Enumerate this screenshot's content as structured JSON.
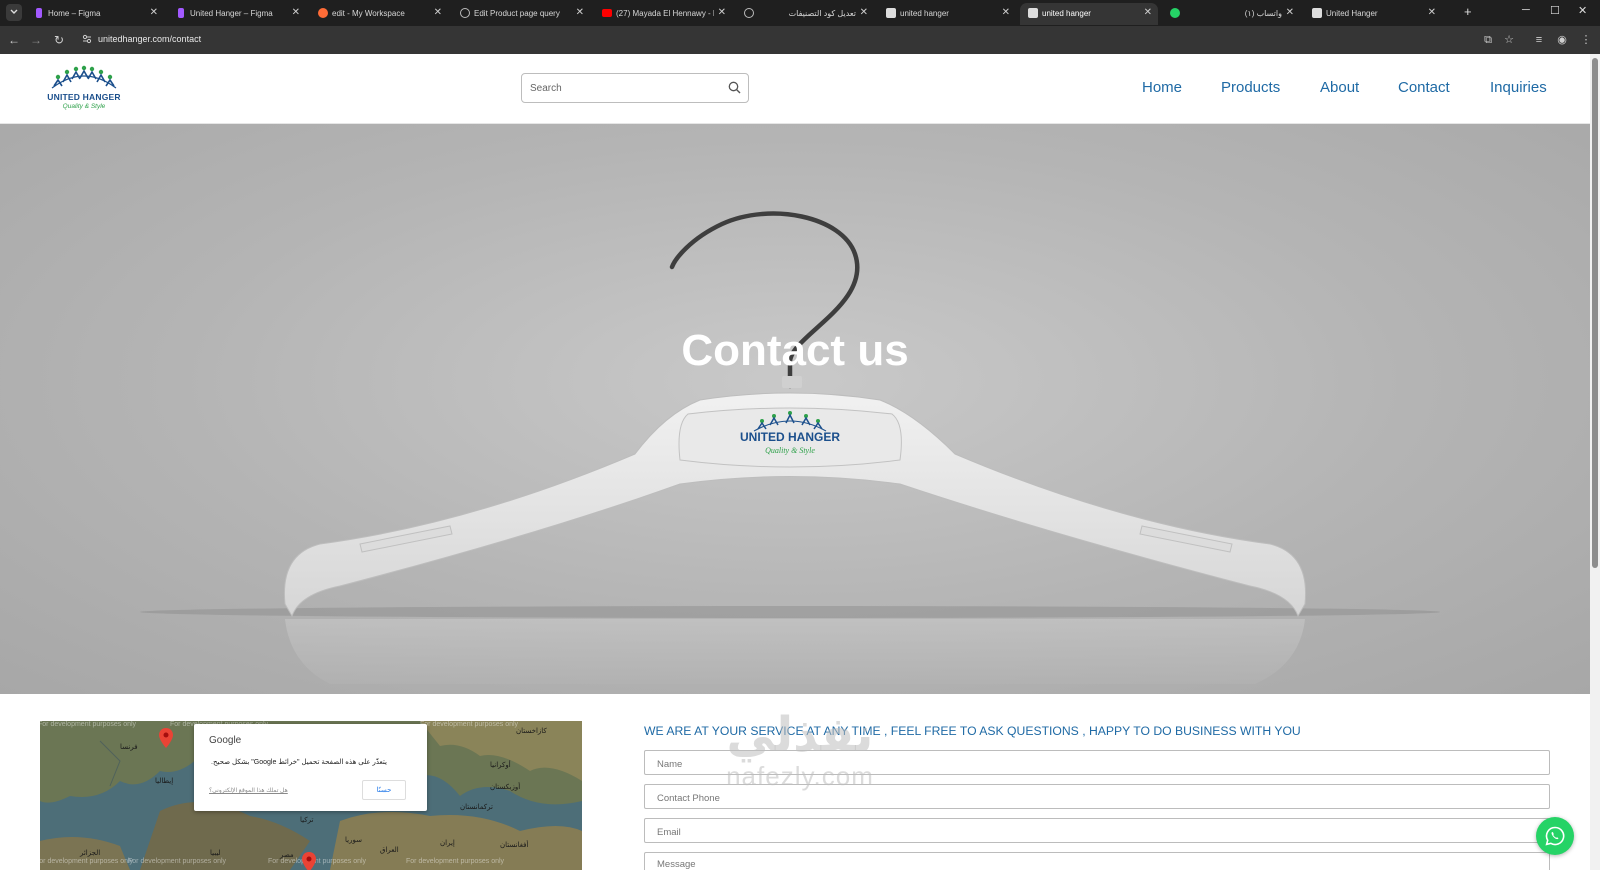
{
  "browser": {
    "tabs": [
      {
        "title": "Home – Figma",
        "favicon_color": "#a259ff",
        "active": false
      },
      {
        "title": "United Hanger – Figma",
        "favicon_color": "#a259ff",
        "active": false
      },
      {
        "title": "edit - My Workspace",
        "favicon_color": "#ff6c37",
        "active": false
      },
      {
        "title": "Edit Product page query",
        "favicon_color": "#bbbbbb",
        "active": false
      },
      {
        "title": "(27) Mayada El Hennawy - Ehi",
        "favicon_color": "#ff0000",
        "active": false
      },
      {
        "title": "تعديل كود التصنيفات",
        "favicon_color": "#bbbbbb",
        "active": false
      },
      {
        "title": "united hanger",
        "favicon_color": "#dddddd",
        "active": false
      },
      {
        "title": "united hanger",
        "favicon_color": "#dddddd",
        "active": true
      },
      {
        "title": "(١) واتساب",
        "favicon_color": "#25d366",
        "active": false
      },
      {
        "title": "United Hanger",
        "favicon_color": "#dddddd",
        "active": false
      }
    ],
    "url": "unitedhanger.com/contact"
  },
  "header": {
    "logo": {
      "name": "UNITED HANGER",
      "tagline": "Quality & Style"
    },
    "search_placeholder": "Search",
    "nav": [
      "Home",
      "Products",
      "About",
      "Contact",
      "Inquiries"
    ]
  },
  "hero": {
    "title": "Contact us",
    "hanger_logo_name": "UNITED HANGER",
    "hanger_logo_tagline": "Quality & Style"
  },
  "contact": {
    "tagline": "WE ARE AT YOUR SERVICE AT ANY TIME , FEEL FREE TO ASK QUESTIONS , HAPPY TO DO BUSINESS WITH YOU",
    "fields": [
      {
        "name": "name",
        "placeholder": "Name"
      },
      {
        "name": "phone",
        "placeholder": "Contact Phone"
      },
      {
        "name": "email",
        "placeholder": "Email"
      },
      {
        "name": "message",
        "placeholder": "Message"
      }
    ]
  },
  "map": {
    "watermark": "For development purposes only",
    "labels": [
      "فرنسا",
      "أوكرانيا",
      "كازاخستان",
      "إيطاليا",
      "تركمانستان",
      "تركيا",
      "أوزبكستان",
      "سوريا",
      "العراق",
      "إيران",
      "أفغانستان",
      "الجزائر",
      "ليبيا",
      "مصر"
    ],
    "dialog": {
      "title": "Google",
      "message": "يتعذّر على هذه الصفحة تحميل \"خرائط Google\" بشكل صحيح.",
      "link": "هل تملك هذا الموقع الإلكتروني؟",
      "button": "حسنًا"
    }
  },
  "watermark": {
    "arabic": "نفذلي",
    "latin": "nafezly.com"
  },
  "colors": {
    "accent": "#1f6aa5",
    "whatsapp": "#25d366",
    "logo_blue": "#1b4f8c",
    "logo_green": "#2ea14a"
  }
}
